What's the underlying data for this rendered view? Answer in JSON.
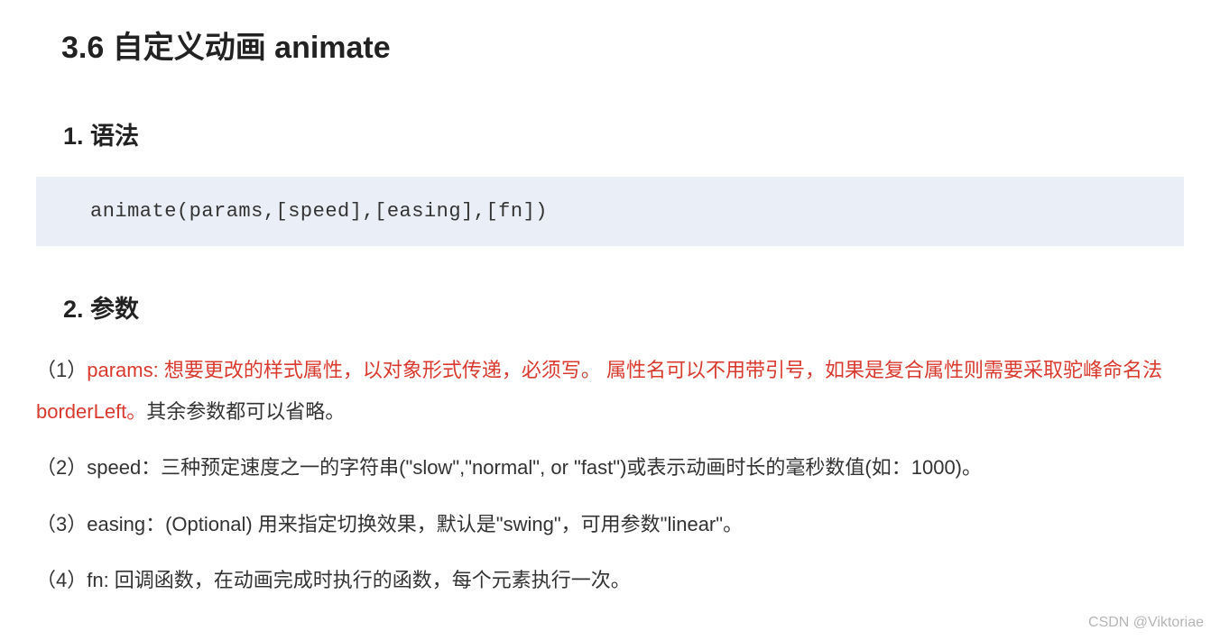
{
  "title": "3.6  自定义动画 animate",
  "section1": {
    "heading": "1. 语法",
    "code": "animate(params,[speed],[easing],[fn])"
  },
  "section2": {
    "heading": "2. 参数",
    "params": {
      "p1_prefix": "（1）",
      "p1_highlight": "params: 想要更改的样式属性，以对象形式传递，必须写。 属性名可以不用带引号，如果是复合属性则需要采取驼峰命名法 borderLeft。",
      "p1_rest": "其余参数都可以省略。",
      "p2": "（2）speed：三种预定速度之一的字符串(\"slow\",\"normal\", or  \"fast\")或表示动画时长的毫秒数值(如：1000)。",
      "p3": "（3）easing：(Optional) 用来指定切换效果，默认是\"swing\"，可用参数\"linear\"。",
      "p4": "（4）fn:  回调函数，在动画完成时执行的函数，每个元素执行一次。"
    }
  },
  "watermark": "CSDN @Viktoriae"
}
